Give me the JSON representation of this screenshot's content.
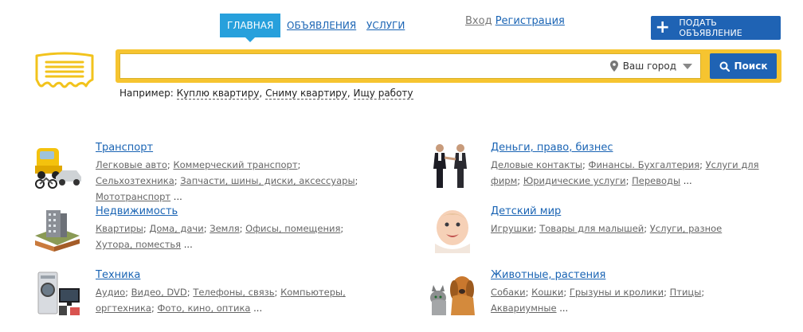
{
  "nav": {
    "tabs": [
      {
        "label": "ГЛАВНАЯ",
        "active": true
      },
      {
        "label": "ОБЪЯВЛЕНИЯ",
        "active": false
      },
      {
        "label": "УСЛУГИ",
        "active": false
      }
    ],
    "login": "Вход",
    "register": "Регистрация",
    "post_button": "ПОДАТЬ ОБЪЯВЛЕНИЕ",
    "post_icon": "plus-icon"
  },
  "search": {
    "query": "",
    "city": "Ваш город",
    "button": "Поиск",
    "accent_color": "#f6c430",
    "button_color": "#1f63b4"
  },
  "examples": {
    "label": "Например:",
    "items": [
      "Куплю квартиру",
      "Сниму квартиру",
      "Ищу работу"
    ]
  },
  "categories": [
    {
      "title": "Транспорт",
      "icon": "truck-icon",
      "subs": [
        "Легковые авто",
        "Коммерческий транспорт",
        "Сельхозтехника",
        "Запчасти, шины, диски, аксессуары",
        "Мототранспорт"
      ]
    },
    {
      "title": "Деньги, право, бизнес",
      "icon": "handshake-icon",
      "subs": [
        "Деловые контакты",
        "Финансы. Бухгалтерия",
        "Услуги для фирм",
        "Юридические услуги",
        "Переводы"
      ]
    },
    {
      "title": "Недвижимость",
      "icon": "building-icon",
      "subs": [
        "Квартиры",
        "Дома, дачи",
        "Земля",
        "Офисы, помещения",
        "Хутора, поместья"
      ]
    },
    {
      "title": "Детский мир",
      "icon": "baby-icon",
      "subs": [
        "Игрушки",
        "Товары для малышей",
        "Услуги, разное"
      ]
    },
    {
      "title": "Техника",
      "icon": "appliances-icon",
      "subs": [
        "Аудио",
        "Видео, DVD",
        "Телефоны, связь",
        "Компьютеры, оргтехника",
        "Фото, кино, оптика"
      ]
    },
    {
      "title": "Животные, растения",
      "icon": "pets-icon",
      "subs": [
        "Собаки",
        "Кошки",
        "Грызуны и кролики",
        "Птицы",
        "Аквариумные"
      ]
    }
  ],
  "more": "..."
}
